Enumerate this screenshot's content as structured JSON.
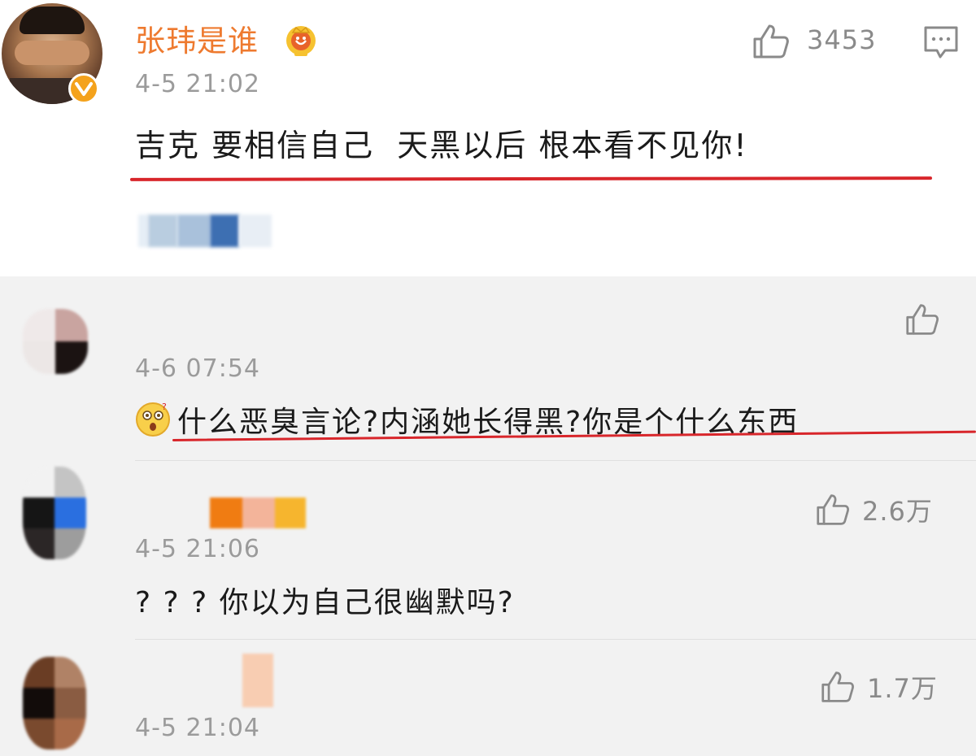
{
  "post": {
    "author": "张玮是谁",
    "time": "4-5 21:02",
    "text": "吉克 要相信自己  天黑以后 根本看不见你!",
    "likes": "3453"
  },
  "replies": [
    {
      "time": "4-6 07:54",
      "text": "什么恶臭言论?内涵她长得黑?你是个什么东西",
      "likes": ""
    },
    {
      "time": "4-5 21:06",
      "text": "? ? ? 你以为自己很幽默吗?",
      "likes": "2.6万"
    },
    {
      "time": "4-5 21:04",
      "text": "",
      "likes": "1.7万"
    }
  ],
  "icons": {
    "like": "thumbs-up-icon",
    "comment": "comment-icon",
    "verified": "verified-badge-icon",
    "crown": "crown-badge-icon",
    "emoji": "surprised-face-emoji"
  },
  "colors": {
    "author_name": "#ee7a2f",
    "underline": "#d8262b",
    "verified": "#f4a21c",
    "reply_bg": "#f2f2f2"
  }
}
